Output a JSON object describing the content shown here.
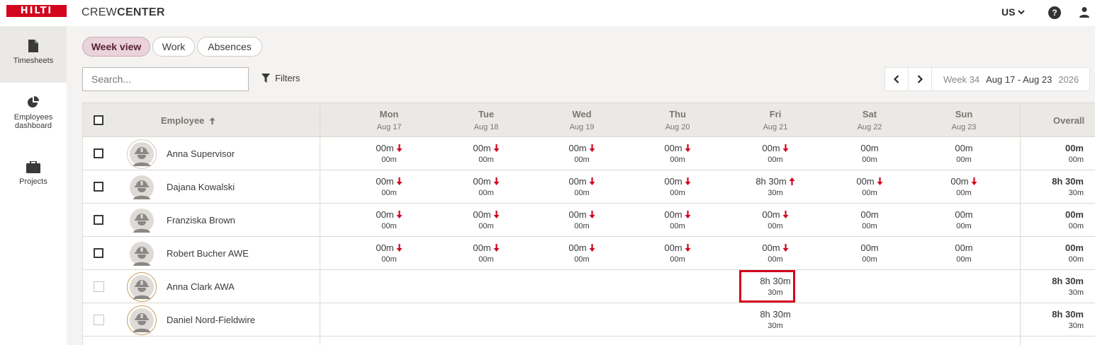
{
  "app": {
    "logo_text": "HILTI",
    "name_light": "CREW",
    "name_bold": "CENTER",
    "region": "US",
    "help_symbol": "?"
  },
  "colors": {
    "brand_red": "#d2051e",
    "active_tab_bg": "#ead3da",
    "header_bg": "#ebe9e5"
  },
  "nav": {
    "items": [
      {
        "label": "Timesheets",
        "icon": "document-icon",
        "active": true
      },
      {
        "label": "Employees dashboard",
        "icon": "pie-chart-icon",
        "active": false
      },
      {
        "label": "Projects",
        "icon": "briefcase-icon",
        "active": false
      }
    ]
  },
  "tabs": [
    {
      "label": "Week view",
      "active": true
    },
    {
      "label": "Work",
      "active": false
    },
    {
      "label": "Absences",
      "active": false
    }
  ],
  "search": {
    "placeholder": "Search..."
  },
  "filters": {
    "label": "Filters"
  },
  "week": {
    "label": "Week 34",
    "range": "Aug 17 - Aug 23",
    "year": "2026"
  },
  "table": {
    "employee_header": "Employee",
    "overall_header": "Overall",
    "days": [
      {
        "name": "Mon",
        "date": "Aug 17"
      },
      {
        "name": "Tue",
        "date": "Aug 18"
      },
      {
        "name": "Wed",
        "date": "Aug 19"
      },
      {
        "name": "Thu",
        "date": "Aug 20"
      },
      {
        "name": "Fri",
        "date": "Aug 21"
      },
      {
        "name": "Sat",
        "date": "Aug 22"
      },
      {
        "name": "Sun",
        "date": "Aug 23"
      }
    ],
    "rows": [
      {
        "name": "Anna Supervisor",
        "checkbox": "enabled",
        "ring": "gray",
        "cells": [
          [
            "00m",
            "00m",
            "down"
          ],
          [
            "00m",
            "00m",
            "down"
          ],
          [
            "00m",
            "00m",
            "down"
          ],
          [
            "00m",
            "00m",
            "down"
          ],
          [
            "00m",
            "00m",
            "down"
          ],
          [
            "00m",
            "00m",
            ""
          ],
          [
            "00m",
            "00m",
            ""
          ]
        ],
        "overall": [
          "00m",
          "00m"
        ]
      },
      {
        "name": "Dajana Kowalski",
        "checkbox": "enabled",
        "ring": "none",
        "cells": [
          [
            "00m",
            "00m",
            "down"
          ],
          [
            "00m",
            "00m",
            "down"
          ],
          [
            "00m",
            "00m",
            "down"
          ],
          [
            "00m",
            "00m",
            "down"
          ],
          [
            "8h 30m",
            "30m",
            "up"
          ],
          [
            "00m",
            "00m",
            "down"
          ],
          [
            "00m",
            "00m",
            "down"
          ]
        ],
        "overall": [
          "8h 30m",
          "30m"
        ]
      },
      {
        "name": "Franziska Brown",
        "checkbox": "enabled",
        "ring": "none",
        "cells": [
          [
            "00m",
            "00m",
            "down"
          ],
          [
            "00m",
            "00m",
            "down"
          ],
          [
            "00m",
            "00m",
            "down"
          ],
          [
            "00m",
            "00m",
            "down"
          ],
          [
            "00m",
            "00m",
            "down"
          ],
          [
            "00m",
            "00m",
            ""
          ],
          [
            "00m",
            "00m",
            ""
          ]
        ],
        "overall": [
          "00m",
          "00m"
        ]
      },
      {
        "name": "Robert Bucher AWE",
        "checkbox": "enabled",
        "ring": "none",
        "cells": [
          [
            "00m",
            "00m",
            "down"
          ],
          [
            "00m",
            "00m",
            "down"
          ],
          [
            "00m",
            "00m",
            "down"
          ],
          [
            "00m",
            "00m",
            "down"
          ],
          [
            "00m",
            "00m",
            "down"
          ],
          [
            "00m",
            "00m",
            ""
          ],
          [
            "00m",
            "00m",
            ""
          ]
        ],
        "overall": [
          "00m",
          "00m"
        ]
      },
      {
        "name": "Anna Clark AWA",
        "checkbox": "disabled",
        "ring": "gold",
        "cells": [
          [
            "",
            "",
            ""
          ],
          [
            "",
            "",
            ""
          ],
          [
            "",
            "",
            ""
          ],
          [
            "",
            "",
            ""
          ],
          [
            "8h 30m",
            "30m",
            ""
          ],
          [
            "",
            "",
            ""
          ],
          [
            "",
            "",
            ""
          ]
        ],
        "overall": [
          "8h 30m",
          "30m"
        ]
      },
      {
        "name": "Daniel Nord-Fieldwire",
        "checkbox": "disabled",
        "ring": "gold",
        "cells": [
          [
            "",
            "",
            ""
          ],
          [
            "",
            "",
            ""
          ],
          [
            "",
            "",
            ""
          ],
          [
            "",
            "",
            ""
          ],
          [
            "8h 30m",
            "30m",
            ""
          ],
          [
            "",
            "",
            ""
          ],
          [
            "",
            "",
            ""
          ]
        ],
        "overall": [
          "8h 30m",
          "30m"
        ]
      }
    ]
  }
}
